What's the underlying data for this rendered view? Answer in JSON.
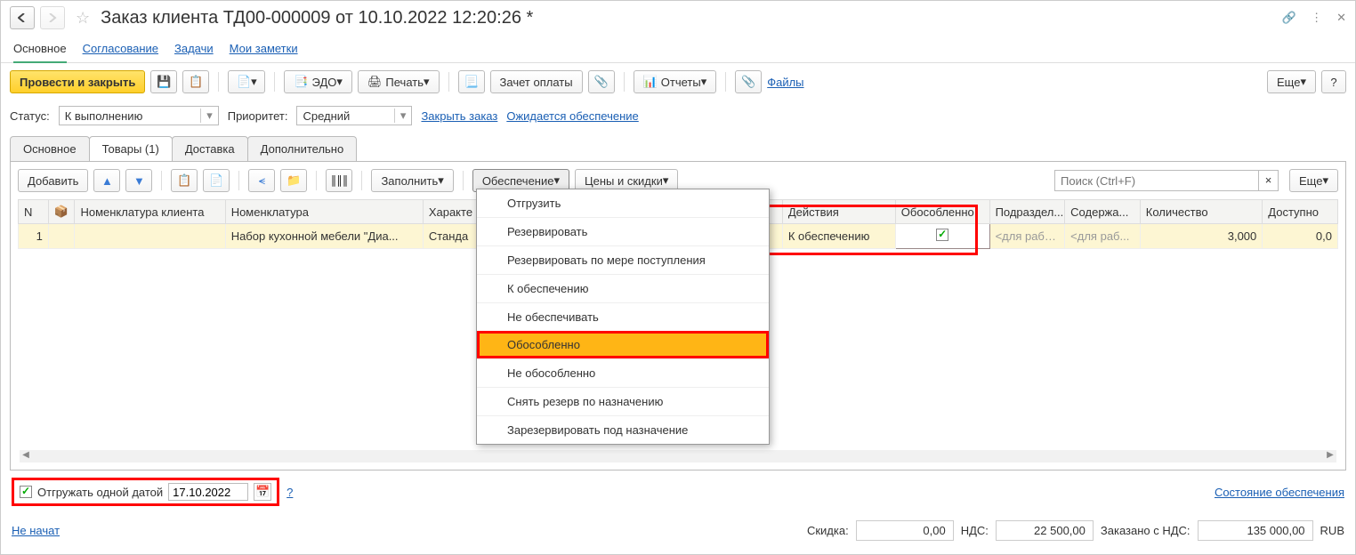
{
  "title": "Заказ клиента ТД00-000009 от 10.10.2022 12:20:26 *",
  "toptabs": {
    "active": "Основное",
    "items": [
      "Основное",
      "Согласование",
      "Задачи",
      "Мои заметки"
    ]
  },
  "toolbar": {
    "run_close": "Провести и закрыть",
    "edo": "ЭДО",
    "print": "Печать",
    "offset": "Зачет оплаты",
    "reports": "Отчеты",
    "files": "Файлы",
    "more": "Еще"
  },
  "status": {
    "label": "Статус:",
    "value": "К выполнению",
    "priority_label": "Приоритет:",
    "priority_value": "Средний",
    "close": "Закрыть заказ",
    "expected": "Ожидается обеспечение"
  },
  "subtabs": [
    "Основное",
    "Товары (1)",
    "Доставка",
    "Дополнительно"
  ],
  "rowbar": {
    "add": "Добавить",
    "fill": "Заполнить",
    "provision": "Обеспечение",
    "prices": "Цены и скидки",
    "search_ph": "Поиск (Ctrl+F)",
    "more": "Еще"
  },
  "grid": {
    "headers": {
      "n": "N",
      "nomc": "Номенклатура клиента",
      "nom": "Номенклатура",
      "char": "Характе",
      "act": "Действия",
      "sep": "Обособленно",
      "dep": "Подраздел...",
      "cont": "Содержа...",
      "qty": "Количество",
      "avail": "Доступно"
    },
    "row": {
      "n": "1",
      "nomc": "",
      "nom": "Набор кухонной мебели \"Диа...",
      "char": "Станда",
      "act": "К обеспечению",
      "sep": true,
      "dep": "<для работ>",
      "cont": "<для раб...",
      "qty": "3,000",
      "avail": "0,0"
    }
  },
  "menu": [
    "Отгрузить",
    "Резервировать",
    "Резервировать по мере поступления",
    "К обеспечению",
    "Не обеспечивать",
    "Обособленно",
    "Не обособленно",
    "Снять резерв по назначению",
    "Зарезервировать под назначение"
  ],
  "footer1": {
    "ship_one": "Отгружать одной датой",
    "date": "17.10.2022",
    "help": "?",
    "state": "Состояние обеспечения"
  },
  "footer2": {
    "notstarted": "Не начат",
    "disc_l": "Скидка:",
    "disc_v": "0,00",
    "vat_l": "НДС:",
    "vat_v": "22 500,00",
    "ord_l": "Заказано с НДС:",
    "ord_v": "135 000,00",
    "cur": "RUB"
  }
}
